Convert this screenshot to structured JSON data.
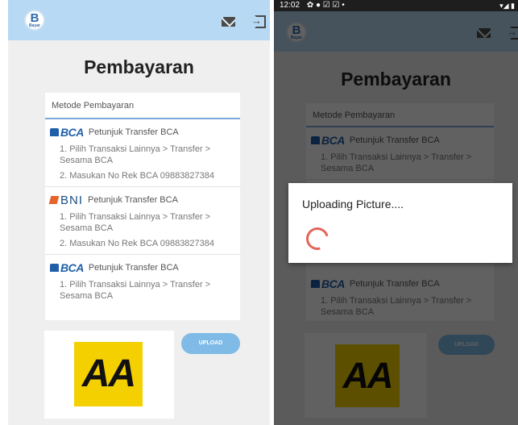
{
  "app": {
    "logo_letter": "B",
    "logo_caption": "Bayar"
  },
  "status_bar": {
    "time": "12:02",
    "left_icons": "✿ ● ☑ ☑ •",
    "right_icons": "▾◢ ▮"
  },
  "page": {
    "title": "Pembayaran"
  },
  "payment_methods": {
    "header": "Metode Pembayaran",
    "banks": [
      {
        "logo": "BCA",
        "name": "Petunjuk Transfer BCA",
        "steps": [
          "1. Pilih Transaksi Lainnya > Transfer > Sesama BCA",
          "2. Masukan No Rek BCA 09883827384"
        ]
      },
      {
        "logo": "BNI",
        "name": "Petunjuk Transfer BCA",
        "steps": [
          "1. Pilih Transaksi Lainnya > Transfer > Sesama BCA",
          "2. Masukan No Rek BCA 09883827384"
        ]
      },
      {
        "logo": "BCA",
        "name": "Petunjuk Transfer BCA",
        "steps": [
          "1. Pilih Transaksi Lainnya > Transfer > Sesama BCA"
        ]
      }
    ]
  },
  "upload": {
    "image_text": "AA",
    "button_label": "UPLOAD"
  },
  "dialog": {
    "title": "Uploading Picture...."
  },
  "icons": {
    "mail": "mail-icon",
    "logout": "logout-icon",
    "spinner": "progress-spinner"
  },
  "colors": {
    "appbar": "#b7d9f3",
    "accent": "#7fa8d8",
    "upload_button": "#7fbbe6",
    "image_bg": "#f5d000",
    "spinner": "#e4645a"
  }
}
